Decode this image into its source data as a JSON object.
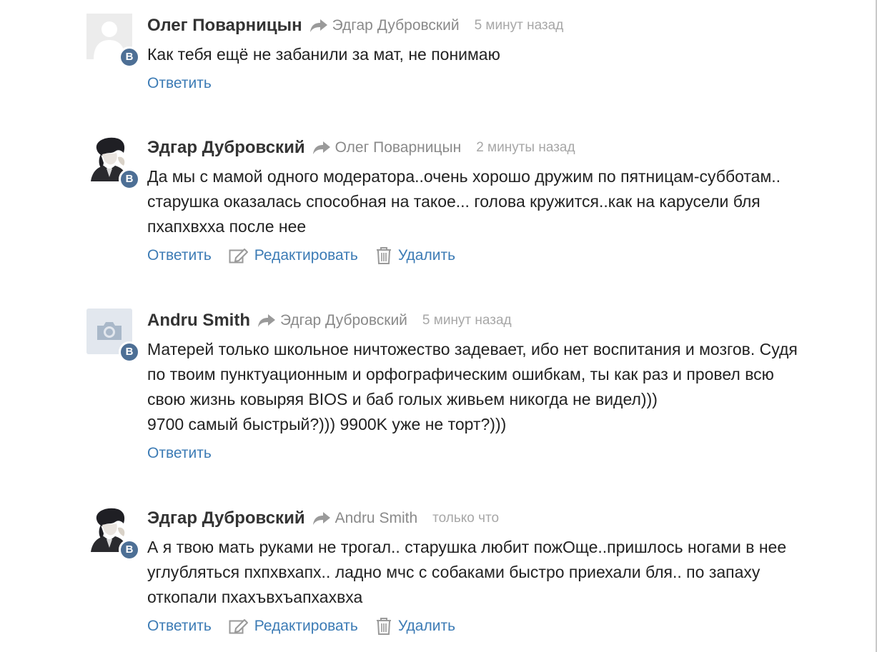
{
  "comments": [
    {
      "author": "Олег Поварницын",
      "reply_to": "Эдгар Дубровский",
      "time": "5 минут назад",
      "avatar": "default-avatar",
      "badge": "В",
      "text": "Как тебя ещё не забанили за мат, не понимаю",
      "actions": {
        "reply": "Ответить"
      }
    },
    {
      "author": "Эдгар Дубровский",
      "reply_to": "Олег Поварницын",
      "time": "2 минуты назад",
      "avatar": "user-photo",
      "badge": "В",
      "text": "Да мы с мамой одного модератора..очень хорошо дружим по пятницам-субботам..\nстарушка оказалась способная на такое... голова кружится..как на карусели бля\nпхапхвхха после нее",
      "actions": {
        "reply": "Ответить",
        "edit": "Редактировать",
        "delete": "Удалить"
      }
    },
    {
      "author": "Andru Smith",
      "reply_to": "Эдгар Дубровский",
      "time": "5 минут назад",
      "avatar": "camera-avatar",
      "badge": "В",
      "text": "Матерей только школьное ничтожество задевает, ибо нет воспитания и мозгов. Судя\nпо твоим пунктуационным и орфографическим ошибкам, ты как раз и провел всю\nсвою жизнь ковыряя BIOS и баб голых живьем никогда не видел)))\n9700 самый быстрый?))) 9900K уже не торт?)))",
      "actions": {
        "reply": "Ответить"
      }
    },
    {
      "author": "Эдгар Дубровский",
      "reply_to": "Andru Smith",
      "time": "только что",
      "avatar": "user-photo",
      "badge": "В",
      "text": "А я твою мать руками не трогал.. старушка любит пожОще..пришлось ногами в нее\nуглубляться пхпхвхапх.. ладно мчс с собаками быстро приехали бля.. по запаху\nоткопали пхахъвхъапхахвха",
      "actions": {
        "reply": "Ответить",
        "edit": "Редактировать",
        "delete": "Удалить"
      }
    }
  ],
  "colors": {
    "link": "#3c7bb5",
    "muted": "#8a8a8a",
    "time": "#a7a7a7",
    "badge": "#4d6f95",
    "text": "#222222"
  }
}
